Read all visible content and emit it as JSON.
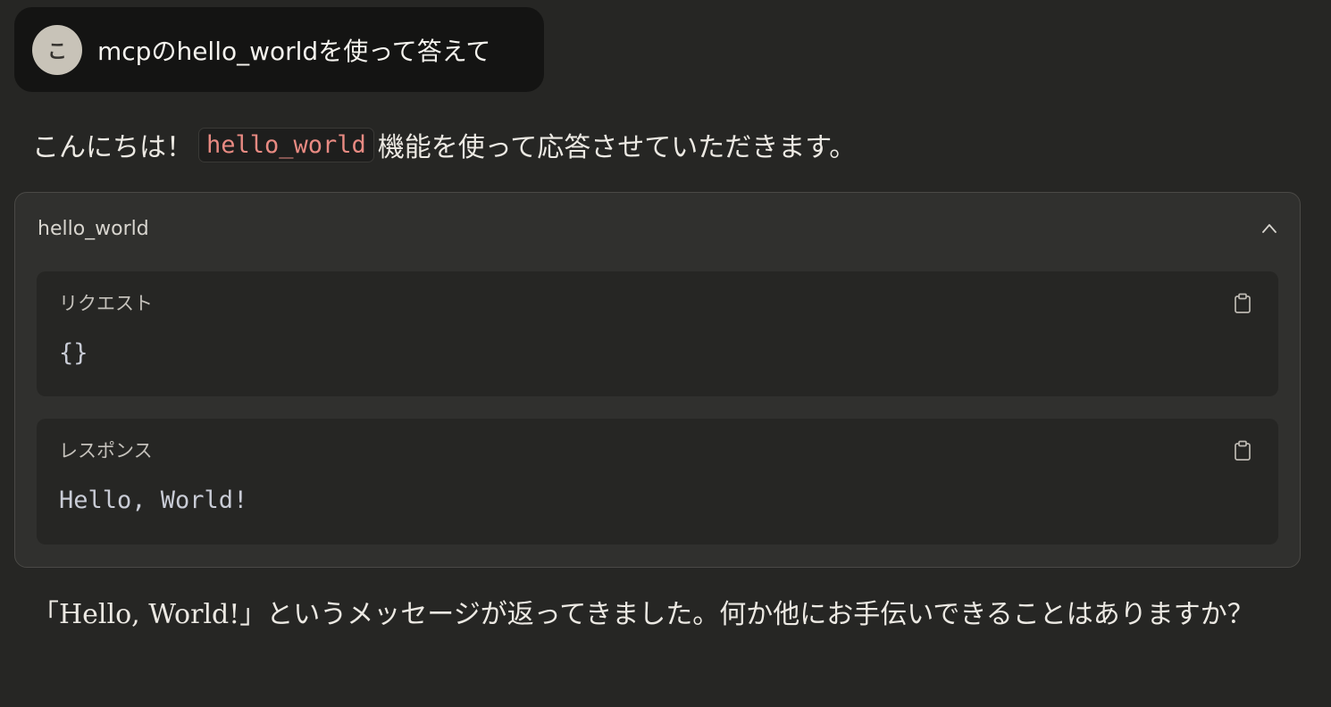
{
  "user_message": {
    "avatar_initial": "こ",
    "text": "mcpのhello_worldを使って答えて"
  },
  "assistant": {
    "intro_prefix": "こんにちは！",
    "intro_code": "hello_world",
    "intro_suffix": "機能を使って応答させていただきます。",
    "closing": "「Hello, World!」というメッセージが返ってきました。何か他にお手伝いできることはありますか？"
  },
  "tool_call": {
    "name": "hello_world",
    "toggle_icon": "chevron-up-icon",
    "request": {
      "label": "リクエスト",
      "body": "{}",
      "copy_icon": "clipboard-icon"
    },
    "response": {
      "label": "レスポンス",
      "body": "Hello, World!",
      "copy_icon": "clipboard-icon"
    }
  },
  "colors": {
    "background": "#262624",
    "user_bubble": "#141413",
    "panel": "#30302e",
    "inline_code_text": "#e88a82"
  }
}
